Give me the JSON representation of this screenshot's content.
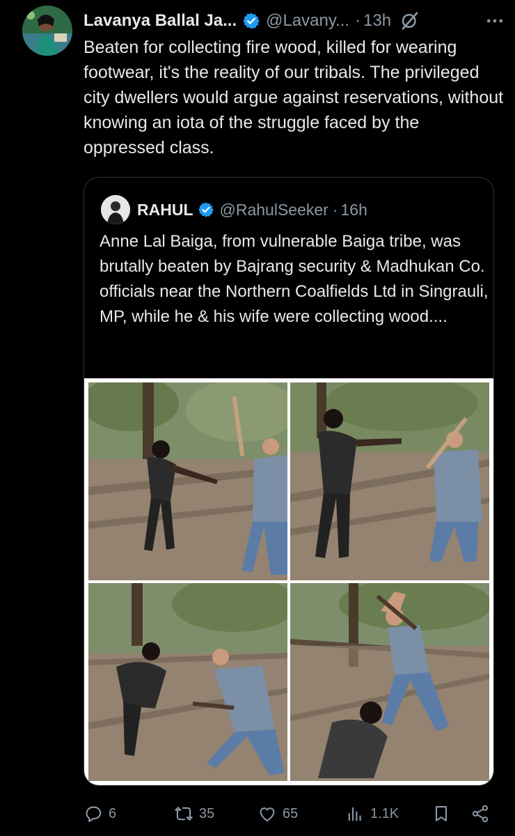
{
  "post": {
    "author_name": "Lavanya Ballal Ja...",
    "handle": "@Lavany...",
    "separator": "·",
    "time": "13h",
    "text": "Beaten for collecting fire wood, killed for wearing footwear, it's the reality of our tribals. The privileged city dwellers would argue against reservations, without knowing an iota of the struggle faced by the oppressed class."
  },
  "quote": {
    "author_name": "RAHUL",
    "handle": "@RahulSeeker",
    "separator": "·",
    "time": "16h",
    "text": "Anne Lal Baiga, from vulnerable Baiga tribe, was brutally beaten by Bajrang security & Madhukan Co. officials near the Northern Coalfields Ltd in Singrauli, MP, while he & his wife were collecting wood...."
  },
  "actions": {
    "replies": "6",
    "reposts": "35",
    "likes": "65",
    "views": "1.1K"
  },
  "colors": {
    "background": "#000000",
    "text": "#e7e9ea",
    "secondary": "#8b98a5",
    "verified": "#1d9bf0",
    "border": "#333639"
  },
  "icons": [
    "verified-badge-icon",
    "grok-icon",
    "more-icon",
    "reply-icon",
    "repost-icon",
    "like-icon",
    "views-icon",
    "bookmark-icon",
    "share-icon"
  ]
}
